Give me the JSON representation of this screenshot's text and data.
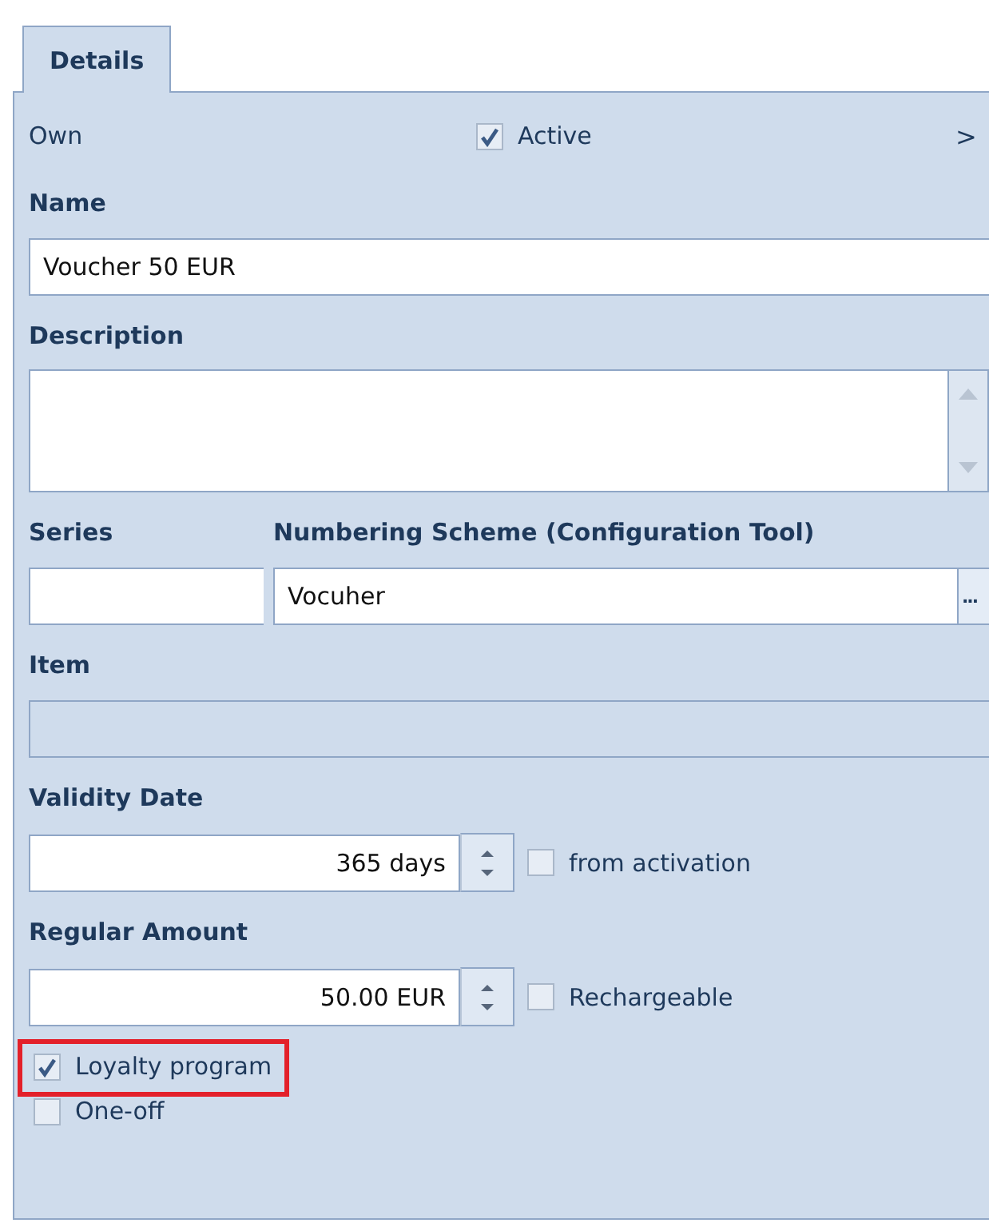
{
  "tabs": [
    {
      "label": "Details",
      "selected": true
    }
  ],
  "header": {
    "owner": "Own",
    "active": {
      "label": "Active",
      "checked": true
    },
    "more": ">"
  },
  "rows": [
    {
      "kind": "text",
      "label": "Name",
      "value": "Voucher 50 EUR"
    },
    {
      "kind": "textarea",
      "label": "Description"
    },
    {
      "kind": "pair",
      "label": "Series",
      "label_2": "Numbering Scheme (Configuration Tool)",
      "value_2": "Vocuher",
      "button": "..."
    },
    {
      "kind": "text",
      "label": "Item",
      "disabled": true
    },
    {
      "kind": "spin",
      "label": "Validity Date",
      "value": "365 days",
      "option": {
        "label": "from activation",
        "checked": false
      }
    },
    {
      "kind": "spin",
      "label": "Regular Amount",
      "value": "50.00 EUR",
      "option": {
        "label": "Rechargeable",
        "checked": false
      }
    }
  ],
  "options": [
    {
      "label": "Loyalty program",
      "checked": true,
      "highlighted": true
    },
    {
      "label": "One-off",
      "checked": false,
      "highlighted": false
    }
  ]
}
